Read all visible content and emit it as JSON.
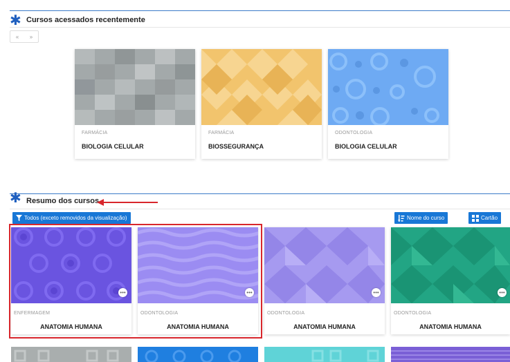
{
  "recent": {
    "title": "Cursos acessados recentemente",
    "pager_prev": "«",
    "pager_next": "»",
    "cards": [
      {
        "category": "FARMÁCIA",
        "name": "BIOLOGIA CELULAR"
      },
      {
        "category": "FARMÁCIA",
        "name": "BIOSSEGURANÇA"
      },
      {
        "category": "ODONTOLOGIA",
        "name": "BIOLOGIA CELULAR"
      }
    ]
  },
  "overview": {
    "title": "Resumo dos cursos",
    "filter_label": "Todos (exceto removidos da visualização)",
    "sort_label": "Nome do curso",
    "view_label": "Cartão",
    "more_label": "•••",
    "cards": [
      {
        "category": "ENFERMAGEM",
        "name": "ANATOMIA HUMANA"
      },
      {
        "category": "ODONTOLOGIA",
        "name": "ANATOMIA HUMANA"
      },
      {
        "category": "ODONTOLOGIA",
        "name": "ANATOMIA HUMANA"
      },
      {
        "category": "ODONTOLOGIA",
        "name": "ANATOMIA HUMANA"
      }
    ]
  },
  "colors": {
    "accent": "#1877d6",
    "highlight_box": "#d8262c",
    "arrow": "#d8262c"
  }
}
